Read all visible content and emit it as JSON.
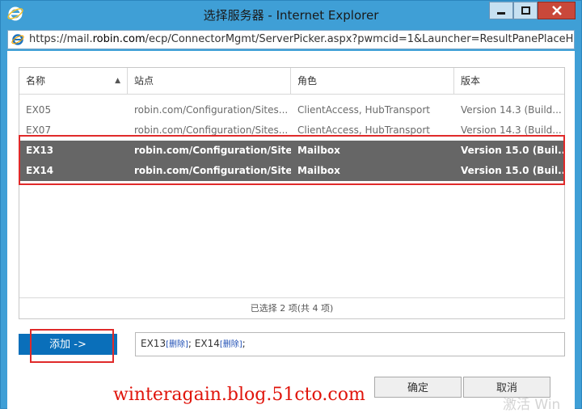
{
  "window": {
    "title": "选择服务器 - Internet Explorer"
  },
  "address": {
    "url_prefix": "https://mail.",
    "url_host": "robin.com",
    "url_path": "/ecp/ConnectorMgmt/ServerPicker.aspx?pwmcid=1&Launcher=ResultPanePlaceHc"
  },
  "grid": {
    "headers": [
      "名称",
      "站点",
      "角色",
      "版本"
    ],
    "rows": [
      {
        "name": "EX05",
        "site": "robin.com/Configuration/Sites...",
        "role": "ClientAccess, HubTransport",
        "version": "Version 14.3 (Build...",
        "selected": false
      },
      {
        "name": "EX07",
        "site": "robin.com/Configuration/Sites...",
        "role": "ClientAccess, HubTransport",
        "version": "Version 14.3 (Build...",
        "selected": false
      },
      {
        "name": "EX13",
        "site": "robin.com/Configuration/Site...",
        "role": "Mailbox",
        "version": "Version 15.0 (Buil...",
        "selected": true
      },
      {
        "name": "EX14",
        "site": "robin.com/Configuration/Site...",
        "role": "Mailbox",
        "version": "Version 15.0 (Buil...",
        "selected": true
      }
    ],
    "status": "已选择 2 项(共 4 项)"
  },
  "actions": {
    "add_label": "添加 ->",
    "selected_items": [
      {
        "name": "EX13",
        "remove": "[删除]",
        "sep": ";"
      },
      {
        "name": "EX14",
        "remove": "[删除]",
        "sep": ";"
      }
    ],
    "ok_label": "确定",
    "cancel_label": "取消"
  },
  "watermarks": {
    "blog": "winteragain.blog.51cto.com",
    "os": "激活 Win"
  },
  "colors": {
    "frame": "#3f9fd6",
    "selected_row": "#666666",
    "add_button": "#0a6fba",
    "highlight": "#e02a2a",
    "link": "#1f4fb5"
  }
}
